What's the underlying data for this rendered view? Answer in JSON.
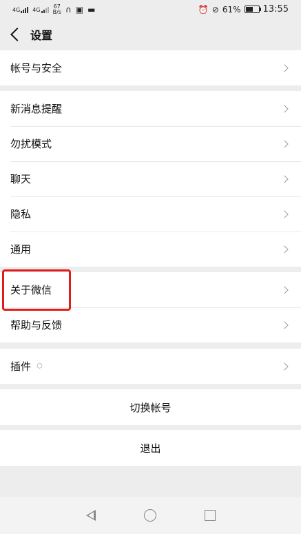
{
  "status_bar": {
    "network_left": "4G",
    "network_right": "4G",
    "speed_value": "67",
    "speed_unit": "B/s",
    "battery": "61%",
    "battery_level": 0.61,
    "time": "13:55"
  },
  "header": {
    "title": "设置"
  },
  "groups": [
    {
      "items": [
        {
          "label": "帐号与安全"
        }
      ]
    },
    {
      "items": [
        {
          "label": "新消息提醒"
        },
        {
          "label": "勿扰模式"
        },
        {
          "label": "聊天"
        },
        {
          "label": "隐私"
        },
        {
          "label": "通用"
        }
      ]
    },
    {
      "items": [
        {
          "label": "关于微信"
        },
        {
          "label": "帮助与反馈"
        }
      ]
    },
    {
      "items": [
        {
          "label": "插件"
        }
      ]
    }
  ],
  "actions": {
    "switch_account": "切换帐号",
    "logout": "退出"
  },
  "highlight_color": "#e11a1a"
}
